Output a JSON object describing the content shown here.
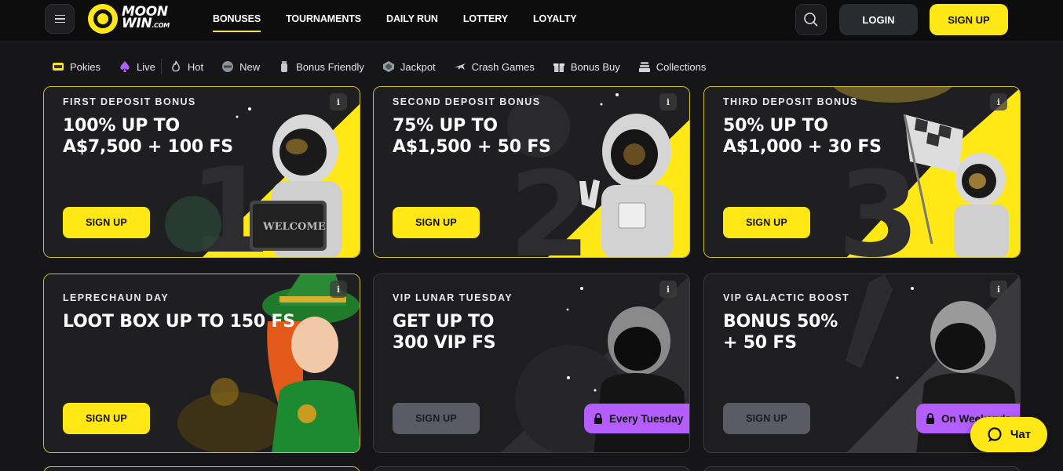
{
  "logo": {
    "line1": "MOON",
    "line2": "WIN",
    "suffix": ".COM"
  },
  "nav": [
    {
      "label": "BONUSES",
      "active": true
    },
    {
      "label": "TOURNAMENTS",
      "active": false
    },
    {
      "label": "DAILY RUN",
      "active": false
    },
    {
      "label": "LOTTERY",
      "active": false
    },
    {
      "label": "LOYALTY",
      "active": false
    }
  ],
  "header": {
    "login": "LOGIN",
    "signup": "SIGN UP"
  },
  "categories": [
    {
      "label": "Pokies",
      "icon": "slot-machine-icon"
    },
    {
      "label": "Live",
      "icon": "spade-icon"
    },
    {
      "label": "Hot",
      "icon": "flame-icon"
    },
    {
      "label": "New",
      "icon": "new-badge-icon"
    },
    {
      "label": "Bonus Friendly",
      "icon": "potion-icon"
    },
    {
      "label": "Jackpot",
      "icon": "jackpot-gem-icon"
    },
    {
      "label": "Crash Games",
      "icon": "plane-icon"
    },
    {
      "label": "Bonus Buy",
      "icon": "gift-icon"
    },
    {
      "label": "Collections",
      "icon": "stack-icon"
    }
  ],
  "cards": [
    {
      "tag": "FIRST DEPOSIT BONUS",
      "title1": "100% UP TO",
      "title2": "A$7,500 + 100 FS",
      "button": "SIGN UP",
      "art": "astronaut-welcome",
      "number": "1"
    },
    {
      "tag": "SECOND DEPOSIT BONUS",
      "title1": "75% UP TO",
      "title2": "A$1,500 + 50 FS",
      "button": "SIGN UP",
      "art": "astronaut-peace",
      "number": "2"
    },
    {
      "tag": "THIRD DEPOSIT BONUS",
      "title1": "50% UP TO",
      "title2": "A$1,000 + 30 FS",
      "button": "SIGN UP",
      "art": "astronaut-flag",
      "number": "3"
    },
    {
      "tag": "LEPRECHAUN DAY",
      "title1": "LOOT BOX UP TO 150 FS",
      "title2": "",
      "button": "SIGN UP",
      "art": "leprechaun-girl"
    },
    {
      "tag": "VIP LUNAR TUESDAY",
      "title1": "GET UP TO",
      "title2": "300 VIP FS",
      "button": "SIGN UP",
      "art": "helmet-silhouette",
      "badge": "Every Tuesday"
    },
    {
      "tag": "VIP GALACTIC BOOST",
      "title1": "BONUS 50%",
      "title2": "+ 50 FS",
      "button": "SIGN UP",
      "art": "helmet-silhouette",
      "badge": "On Weekends"
    }
  ],
  "info_symbol": "i",
  "chat": {
    "label": "Чат"
  },
  "colors": {
    "accent": "#ffe815",
    "badge": "#b45eff",
    "bg": "#161618"
  }
}
